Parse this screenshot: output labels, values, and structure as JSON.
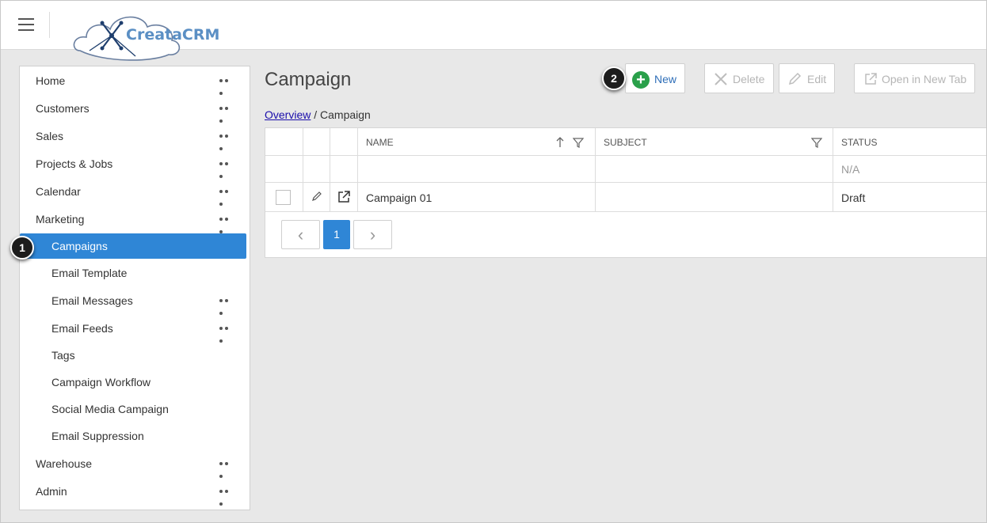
{
  "app": {
    "logo_text": "CreataCRM"
  },
  "sidebar": {
    "items": [
      {
        "label": "Home",
        "has_menu": true
      },
      {
        "label": "Customers",
        "has_menu": true
      },
      {
        "label": "Sales",
        "has_menu": true
      },
      {
        "label": "Projects & Jobs",
        "has_menu": true
      },
      {
        "label": "Calendar",
        "has_menu": true
      },
      {
        "label": "Marketing",
        "has_menu": true
      },
      {
        "label": "Campaigns",
        "active": true
      },
      {
        "label": "Email Template"
      },
      {
        "label": "Email Messages",
        "has_menu": true
      },
      {
        "label": "Email Feeds",
        "has_menu": true
      },
      {
        "label": "Tags"
      },
      {
        "label": "Campaign Workflow"
      },
      {
        "label": "Social Media Campaign"
      },
      {
        "label": "Email Suppression"
      },
      {
        "label": "Warehouse",
        "has_menu": true
      },
      {
        "label": "Admin",
        "has_menu": true
      }
    ]
  },
  "callouts": {
    "one": "1",
    "two": "2"
  },
  "main": {
    "title": "Campaign",
    "toolbar": {
      "new_label": "New",
      "delete_label": "Delete",
      "edit_label": "Edit",
      "open_new_tab_label": "Open in New Tab"
    },
    "breadcrumb": {
      "link": "Overview",
      "separator": " / ",
      "current": "Campaign"
    },
    "table": {
      "columns": [
        "NAME",
        "SUBJECT",
        "STATUS"
      ],
      "filter_row": {
        "status": "N/A"
      },
      "rows": [
        {
          "name": "Campaign 01",
          "subject": "",
          "status": "Draft"
        }
      ]
    },
    "pager": {
      "current_page": "1",
      "prev": "‹",
      "next": "›"
    }
  },
  "colors": {
    "accent": "#2f86d6",
    "new_icon": "#2aa04a",
    "link": "#1a0dab"
  }
}
